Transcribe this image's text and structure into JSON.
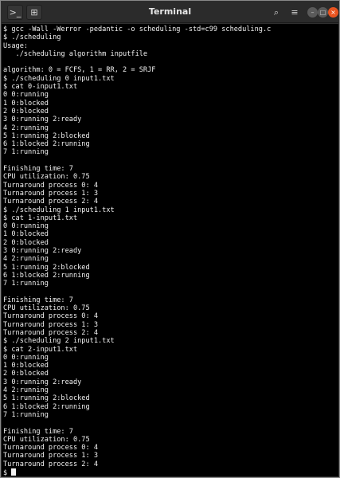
{
  "window": {
    "title": "Terminal",
    "new_tab_icon": "⊞",
    "search_icon": "⌕",
    "menu_icon": "≡",
    "minimize_icon": "–",
    "maximize_icon": "□",
    "close_icon": "×"
  },
  "terminal": {
    "lines": [
      "$ gcc -Wall -Werror -pedantic -o scheduling -std=c99 scheduling.c",
      "$ ./scheduling",
      "Usage:",
      "   ./scheduling algorithm inputfile",
      "",
      "algorithm: 0 = FCFS, 1 = RR, 2 = SRJF",
      "$ ./scheduling 0 input1.txt",
      "$ cat 0-input1.txt",
      "0 0:running",
      "1 0:blocked",
      "2 0:blocked",
      "3 0:running 2:ready",
      "4 2:running",
      "5 1:running 2:blocked",
      "6 1:blocked 2:running",
      "7 1:running",
      "",
      "Finishing time: 7",
      "CPU utilization: 0.75",
      "Turnaround process 0: 4",
      "Turnaround process 1: 3",
      "Turnaround process 2: 4",
      "$ ./scheduling 1 input1.txt",
      "$ cat 1-input1.txt",
      "0 0:running",
      "1 0:blocked",
      "2 0:blocked",
      "3 0:running 2:ready",
      "4 2:running",
      "5 1:running 2:blocked",
      "6 1:blocked 2:running",
      "7 1:running",
      "",
      "Finishing time: 7",
      "CPU utilization: 0.75",
      "Turnaround process 0: 4",
      "Turnaround process 1: 3",
      "Turnaround process 2: 4",
      "$ ./scheduling 2 input1.txt",
      "$ cat 2-input1.txt",
      "0 0:running",
      "1 0:blocked",
      "2 0:blocked",
      "3 0:running 2:ready",
      "4 2:running",
      "5 1:running 2:blocked",
      "6 1:blocked 2:running",
      "7 1:running",
      "",
      "Finishing time: 7",
      "CPU utilization: 0.75",
      "Turnaround process 0: 4",
      "Turnaround process 1: 3",
      "Turnaround process 2: 4"
    ],
    "prompt": "$ "
  }
}
